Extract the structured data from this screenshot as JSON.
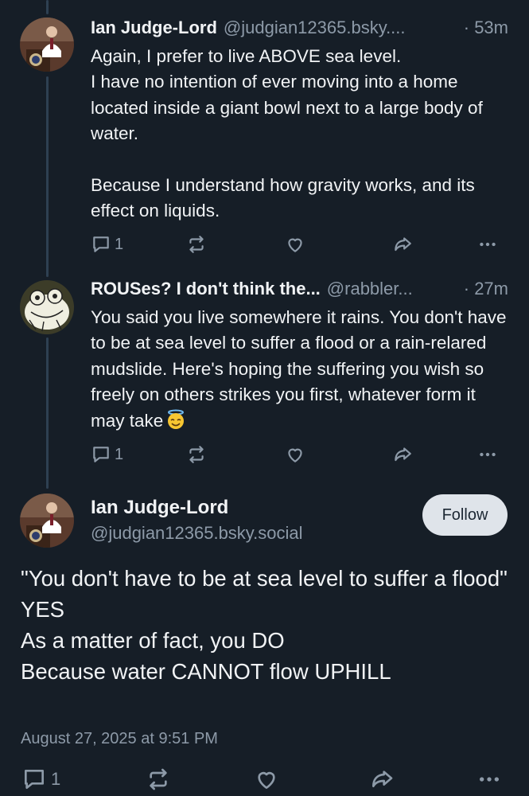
{
  "posts": [
    {
      "author_name": "Ian Judge-Lord",
      "author_handle": "@judgian12365.bsky....",
      "time": "· 53m",
      "text": "Again, I prefer to live ABOVE sea level.\nI have no intention of ever moving into a home located inside a giant bowl next to a large body of water.\n\nBecause I understand how gravity works, and its effect on liquids.",
      "reply_count": "1",
      "avatar_icon": "person-portrait"
    },
    {
      "author_name": "ROUSes? I don't think the...",
      "author_handle": "@rabbler...",
      "time": "· 27m",
      "text": "You said you live somewhere it rains. You don't have to be at sea level to suffer a flood or a rain-relared mudslide. Here's hoping the suffering you wish so freely on others strikes you first, whatever form it may take",
      "emoji": "smiling-face-with-halo",
      "reply_count": "1",
      "avatar_icon": "frog-sketch"
    }
  ],
  "main_post": {
    "author_name": "Ian Judge-Lord",
    "author_handle": "@judgian12365.bsky.social",
    "follow_label": "Follow",
    "text": "\"You don't have to be at sea level to suffer a flood\"\nYES\nAs a matter of fact, you DO\nBecause water CANNOT flow UPHILL",
    "date": "August 27, 2025 at 9:51 PM",
    "reply_count": "1"
  },
  "icons": [
    "reply-icon",
    "repost-icon",
    "like-icon",
    "share-icon",
    "more-icon"
  ],
  "colors": {
    "background": "#161e27",
    "text": "#f1f3f5",
    "muted": "#8d9aa8",
    "thread_line": "#2e4052",
    "follow_button": "#dfe4ea"
  }
}
